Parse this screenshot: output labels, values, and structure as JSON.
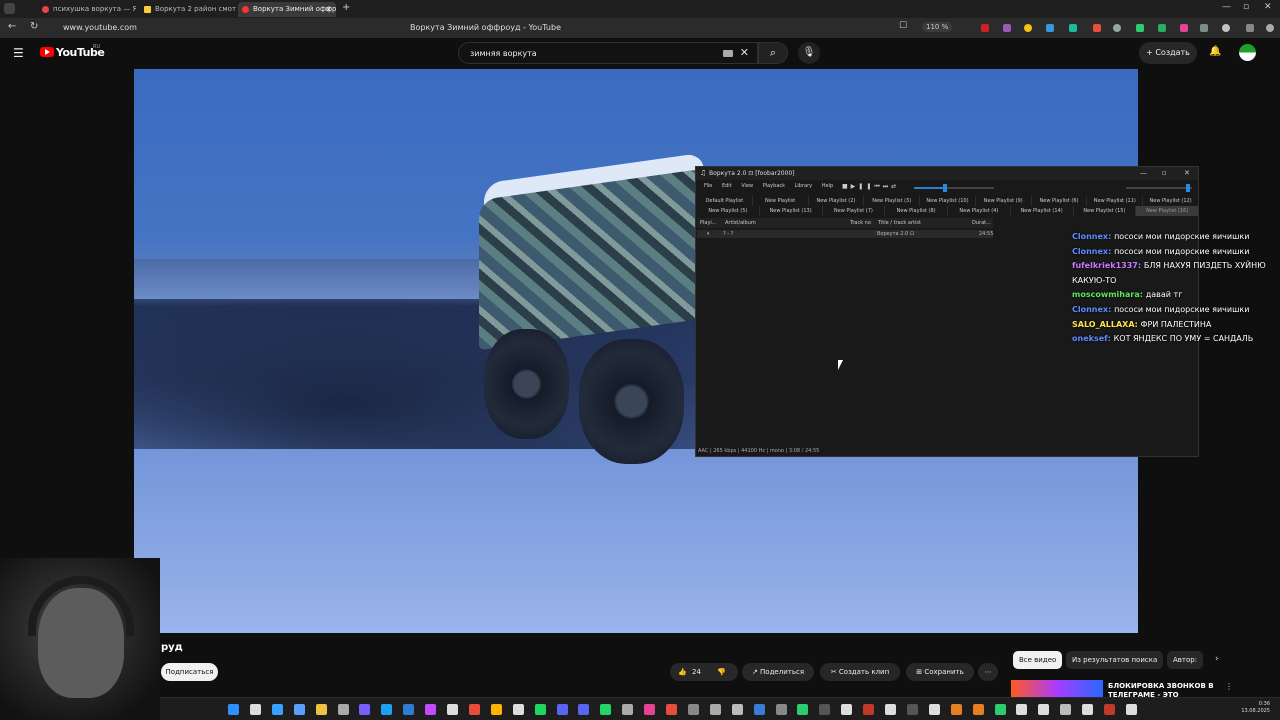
{
  "browser": {
    "tabs": [
      {
        "label": "психушка воркута — Янд",
        "color": "#e44"
      },
      {
        "label": "Воркута 2 район смотре",
        "color": "#fc3"
      },
      {
        "label": "Воркута Зимний оффро",
        "color": "#f33"
      }
    ],
    "url": "www.youtube.com",
    "page_title": "Воркута Зимний оффроуд - YouTube",
    "zoom": "110 %"
  },
  "youtube": {
    "logo": "YouTube",
    "region": "RU",
    "search_value": "зимняя воркута",
    "create_label": "Создать"
  },
  "foobar": {
    "title": "Воркута 2.0 ⊡ [foobar2000]",
    "menu": [
      "File",
      "Edit",
      "View",
      "Playback",
      "Library",
      "Help"
    ],
    "seek_fraction": 0.36,
    "volume_fraction": 0.97,
    "playlist_rows": [
      [
        "Default Playlist",
        "New Playlist",
        "New Playlist (2)",
        "New Playlist (3)",
        "New Playlist (10)",
        "New Playlist (9)",
        "New Playlist (6)",
        "New Playlist (11)",
        "New Playlist (12)"
      ],
      [
        "New Playlist (5)",
        "New Playlist (13)",
        "New Playlist (7)",
        "New Playlist (8)",
        "New Playlist (4)",
        "New Playlist (14)",
        "New Playlist (15)",
        "New Playlist (16)"
      ]
    ],
    "columns": {
      "playing": "Playi...",
      "artist": "Artist/album",
      "track": "Track no",
      "title": "Title / track artist",
      "duration": "Durat..."
    },
    "row": {
      "playing": "⏸",
      "artist": "? - ?",
      "title": "Воркута 2.0 ⊡",
      "duration": "24:55"
    },
    "status": "AAC | 265 kbps | 44100 Hz | mono | 3:08 / 24:55"
  },
  "chat": [
    {
      "nick": "Clonnex:",
      "color": "#5b8cff",
      "text": "пососи мои пидорские яичишки"
    },
    {
      "nick": "Clonnex:",
      "color": "#5b8cff",
      "text": "пососи мои пидорские яичишки"
    },
    {
      "nick": "fufelkriek1337:",
      "color": "#c77dff",
      "text": "БЛЯ НАХУЯ ПИЗДЕТЬ ХУЙНЮ"
    },
    {
      "nick": "",
      "color": "#fff",
      "text": "КАКУЮ-ТО"
    },
    {
      "nick": "moscowmihara:",
      "color": "#5ee65e",
      "text": "давай тг"
    },
    {
      "nick": "Clonnex:",
      "color": "#5b8cff",
      "text": "пососи мои пидорские яичишки"
    },
    {
      "nick": "SALO_ALLAXA:",
      "color": "#ffe14d",
      "text": "ФРИ ПАЛЕСТИНА"
    },
    {
      "nick": "oneksef:",
      "color": "#5b8cff",
      "text": "КОТ ЯНДЕКС ПО УМУ = САНДАЛЬ"
    }
  ],
  "video_info": {
    "title_fragment": "руд",
    "subscribe_label": "Подписаться",
    "likes": "24",
    "share_label": "Поделиться",
    "clip_label": "Создать клип",
    "save_label": "Сохранить",
    "more_label": "⋯"
  },
  "filters": [
    "Все видео",
    "Из результатов поиска",
    "Автор: "
  ],
  "recommendation": {
    "title": "БЛОКИРОВКА ЗВОНКОВ В ТЕЛЕГРАМЕ - ЭТО ПОЗОРИЩЕ"
  },
  "taskbar": {
    "time": "0:36",
    "date": "13.08.2025"
  }
}
